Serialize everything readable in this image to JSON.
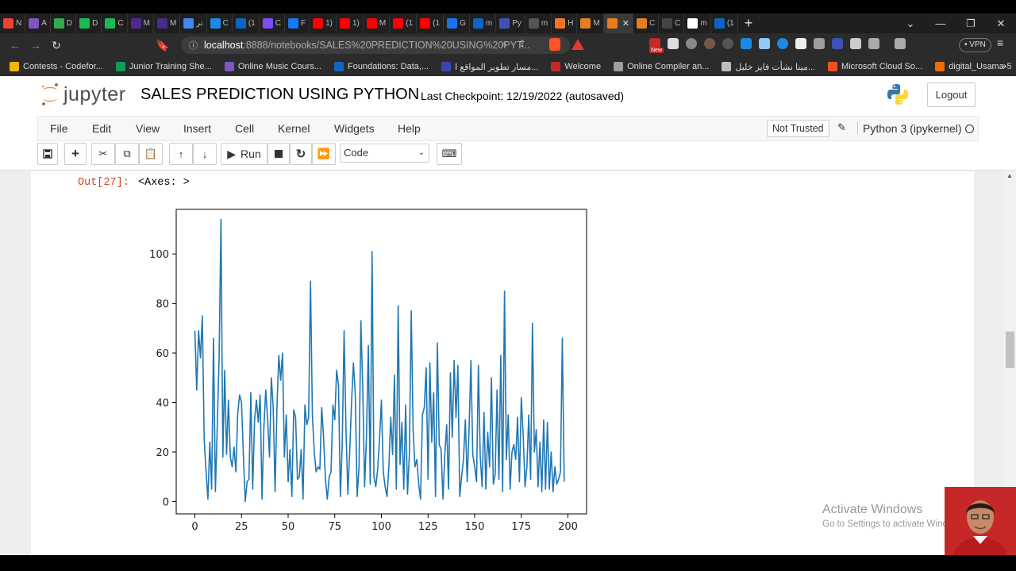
{
  "browser": {
    "tabs": [
      {
        "label": "N",
        "color": "#ea4335"
      },
      {
        "label": "A",
        "color": "#7e57c2"
      },
      {
        "label": "D",
        "color": "#34a853"
      },
      {
        "label": "D",
        "color": "#1db954"
      },
      {
        "label": "C",
        "color": "#1db954"
      },
      {
        "label": "M",
        "color": "#4a2a8c"
      },
      {
        "label": "M",
        "color": "#4a2a8c"
      },
      {
        "label": "تر",
        "color": "#4285f4"
      },
      {
        "label": "C",
        "color": "#1e88e5"
      },
      {
        "label": "(1",
        "color": "#0a66c2"
      },
      {
        "label": "C",
        "color": "#7c4dff"
      },
      {
        "label": "F",
        "color": "#1877f2"
      },
      {
        "label": "1)",
        "color": "#ff0000"
      },
      {
        "label": "1)",
        "color": "#ff0000"
      },
      {
        "label": "M",
        "color": "#ff0000"
      },
      {
        "label": "(1",
        "color": "#ff0000"
      },
      {
        "label": "(1",
        "color": "#ff0000"
      },
      {
        "label": "G",
        "color": "#1a73e8"
      },
      {
        "label": "m",
        "color": "#0a66c2"
      },
      {
        "label": "Py",
        "color": "#3f51b5"
      },
      {
        "label": "m",
        "color": "#555555"
      },
      {
        "label": "H",
        "color": "#f37626"
      },
      {
        "label": "M",
        "color": "#e67e22"
      },
      {
        "label": "",
        "color": "#e67e22",
        "active": true
      },
      {
        "label": "C",
        "color": "#e67e22"
      },
      {
        "label": "C",
        "color": "#444444"
      },
      {
        "label": "m",
        "color": "#ffffff"
      },
      {
        "label": "(1",
        "color": "#0a66c2"
      }
    ],
    "tab_close": "✕",
    "new_tab": "+",
    "url_host": "localhost",
    "url_path": ":8888/notebooks/SALES%20PREDICTION%20USING%20PYT...",
    "vpn_label": "• VPN",
    "ext_badge": "New",
    "bookmarks": [
      {
        "label": "Contests - Codefor...",
        "color": "#f4b400"
      },
      {
        "label": "Junior Training She...",
        "color": "#0f9d58"
      },
      {
        "label": "Online Music Cours...",
        "color": "#7e57c2"
      },
      {
        "label": "Foundations: Data,...",
        "color": "#1565c0"
      },
      {
        "label": "مسار تطوير المواقع ا...",
        "color": "#3949ab"
      },
      {
        "label": "Welcome",
        "color": "#c62828"
      },
      {
        "label": "Online Compiler an...",
        "color": "#9e9e9e"
      },
      {
        "label": "مينا نشأت فايز خليل...",
        "color": "#bdbdbd"
      },
      {
        "label": "Microsoft Cloud So...",
        "color": "#f25022"
      },
      {
        "label": "digital_Usama-5",
        "color": "#ef6c00"
      }
    ],
    "bookmarks_more": "»"
  },
  "jupyter": {
    "logo_text": "jupyter",
    "notebook_title": "SALES PREDICTION USING PYTHON",
    "checkpoint": "Last Checkpoint: 12/19/2022  (autosaved)",
    "logout_label": "Logout",
    "menu": [
      "File",
      "Edit",
      "View",
      "Insert",
      "Cell",
      "Kernel",
      "Widgets",
      "Help"
    ],
    "trust_label": "Not Trusted",
    "kernel_label": "Python 3 (ipykernel)",
    "run_label": "Run",
    "cell_type": "Code",
    "toolbar_icons": [
      "save-icon",
      "add-cell-icon",
      "cut-icon",
      "copy-icon",
      "paste-icon",
      "move-up-icon",
      "move-down-icon",
      "run-icon",
      "stop-icon",
      "restart-icon",
      "fast-forward-icon",
      "keyboard-icon"
    ]
  },
  "cell": {
    "prompt": "Out[27]:",
    "text": "<Axes: >"
  },
  "overlay": {
    "activate_title": "Activate Windows",
    "activate_sub": "Go to Settings to activate Windows."
  },
  "chart_data": {
    "type": "line",
    "title": "",
    "xlabel": "",
    "ylabel": "",
    "xlim": [
      -10,
      210
    ],
    "ylim": [
      -5,
      118
    ],
    "xticks": [
      0,
      25,
      50,
      75,
      100,
      125,
      150,
      175,
      200
    ],
    "yticks": [
      0,
      20,
      40,
      60,
      80,
      100
    ],
    "grid": false,
    "color": "#1f77b4",
    "series": [
      {
        "name": "",
        "values": [
          69,
          45,
          69,
          58,
          75,
          25,
          12,
          1,
          24,
          5,
          66,
          4,
          30,
          58,
          114,
          18,
          53,
          19,
          41,
          18,
          14,
          22,
          12,
          36,
          43,
          40,
          19,
          0,
          8,
          9,
          44,
          5,
          33,
          41,
          32,
          43,
          1,
          30,
          45,
          33,
          18,
          50,
          38,
          4,
          38,
          59,
          49,
          60,
          18,
          35,
          8,
          21,
          2,
          37,
          34,
          9,
          10,
          21,
          1,
          39,
          31,
          34,
          89,
          35,
          20,
          12,
          14,
          13,
          38,
          26,
          9,
          1,
          10,
          12,
          39,
          33,
          53,
          47,
          2,
          23,
          69,
          30,
          3,
          20,
          40,
          56,
          43,
          2,
          14,
          73,
          46,
          6,
          26,
          63,
          7,
          101,
          10,
          6,
          13,
          25,
          41,
          12,
          6,
          2,
          14,
          34,
          19,
          51,
          5,
          79,
          15,
          32,
          5,
          39,
          3,
          19,
          77,
          29,
          14,
          17,
          7,
          1,
          35,
          38,
          54,
          9,
          56,
          24,
          44,
          2,
          64,
          23,
          21,
          1,
          19,
          31,
          5,
          52,
          26,
          57,
          34,
          55,
          2,
          10,
          17,
          33,
          8,
          29,
          57,
          19,
          14,
          8,
          55,
          18,
          6,
          36,
          5,
          28,
          14,
          50,
          7,
          11,
          45,
          9,
          59,
          4,
          85,
          17,
          35,
          5,
          20,
          23,
          17,
          34,
          8,
          42,
          27,
          6,
          14,
          35,
          9,
          72,
          20,
          29,
          6,
          24,
          4,
          33,
          5,
          32,
          5,
          20,
          4,
          14,
          7,
          9,
          12,
          66,
          8
        ]
      }
    ]
  }
}
